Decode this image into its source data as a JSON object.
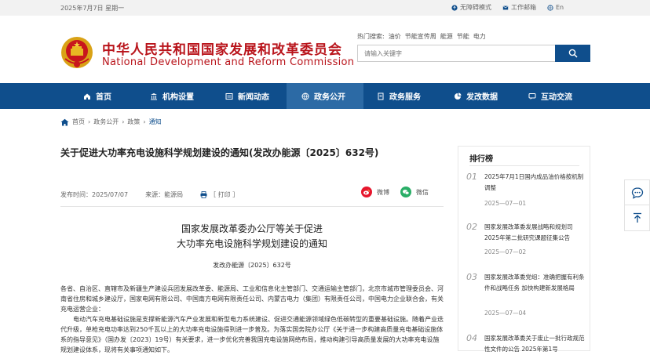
{
  "topbar": {
    "date": "2025年7月7日 星期一",
    "accessibility": "无障碍模式",
    "mail": "工作邮箱",
    "lang": "En"
  },
  "header": {
    "title_cn": "中华人民共和国国家发展和改革委员会",
    "title_en": "National Development and Reform Commission",
    "hot_label": "热门搜索:",
    "hot_terms": [
      "油价",
      "节能宣传周",
      "能源",
      "节能",
      "电力"
    ],
    "search_placeholder": "请输入关键字"
  },
  "nav": {
    "items": [
      {
        "label": "首页",
        "icon": "home-icon"
      },
      {
        "label": "机构设置",
        "icon": "building-icon"
      },
      {
        "label": "新闻动态",
        "icon": "news-icon"
      },
      {
        "label": "政务公开",
        "icon": "globe-icon"
      },
      {
        "label": "政务服务",
        "icon": "document-icon"
      },
      {
        "label": "发改数据",
        "icon": "chart-icon"
      },
      {
        "label": "互动交流",
        "icon": "chat-icon"
      }
    ],
    "active_index": 3
  },
  "breadcrumb": [
    "首页",
    "政务公开",
    "政策",
    "通知"
  ],
  "article": {
    "title": "关于促进大功率充电设施科学规划建设的通知(发改办能源〔2025〕632号)",
    "publish_time": "发布时间：2025/07/07",
    "source": "来源：能源局",
    "print": "［ 打印 ］",
    "share_weibo": "微博",
    "share_wechat": "微信",
    "doc_heading_1": "国家发展改革委办公厅等关于促进",
    "doc_heading_2": "大功率充电设施科学规划建设的通知",
    "doc_number": "发改办能源〔2025〕632号",
    "para1": "各省、自治区、直辖市及新疆生产建设兵团发展改革委、能源局、工业和信息化主管部门、交通运输主管部门，北京市城市管理委员会、河南省住房和城乡建设厅，国家电网有限公司、中国南方电网有限责任公司、内蒙古电力（集团）有限责任公司，中国电力企业联合会，有关充电运营企业：",
    "para2": "电动汽车充电基础设施是支撑新能源汽车产业发展和新型电力系统建设、促进交通能源领域绿色低碳转型的重要基础设施。随着产业迭代升级，单枪充电功率达到250千瓦以上的大功率充电设施得到进一步普及。为落实国务院办公厅《关于进一步构建高质量充电基础设施体系的指导意见》（国办发〔2023〕19号）有关要求，进一步优化完善我国充电设施网络布局，推动构建引导高质量发展的大功率充电设施规划建设体系，现将有关事项通知如下。"
  },
  "ranking": {
    "title": "排行榜",
    "items": [
      {
        "num": "01",
        "text": "2025年7月1日国内成品油价格按机制调整",
        "date": "2025—07—01"
      },
      {
        "num": "02",
        "text": "国家发展改革委发展战略和规划司2025年第二批研究课题征集公告",
        "date": "2025—07—02"
      },
      {
        "num": "03",
        "text": "国家发展改革委党组：准确把握有利条件和战略任务 加快构建新发展格局",
        "date": "2025—07—04"
      },
      {
        "num": "04",
        "text": "国家发展改革委关于废止一批行政规范性文件的公告 2025年第1号",
        "date": ""
      }
    ]
  }
}
